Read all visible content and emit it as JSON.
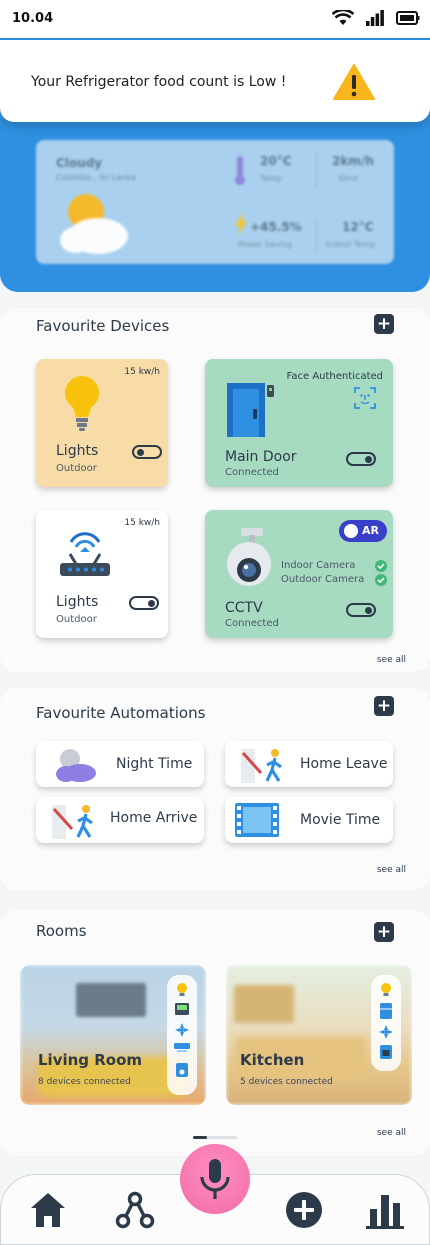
{
  "status": {
    "time": "10.04"
  },
  "notification": {
    "text": "Your Refrigerator food count is Low !"
  },
  "weather": {
    "condition": "Cloudy",
    "location": "Colombo , Sri Lanka",
    "temp": "20°C",
    "temp_label": "Temp",
    "wind": "2km/h",
    "wind_label": "Wind",
    "saving": "+45.5%",
    "saving_label": "Power Saving",
    "indoor": "12°C",
    "indoor_label": "Indoor Temp"
  },
  "favourites": {
    "title": "Favourite Devices",
    "see_all": "see all",
    "devices": [
      {
        "name": "Lights",
        "sub": "Outdoor",
        "kw": "15 kw/h"
      },
      {
        "name": "Main Door",
        "sub": "Connected",
        "note": "Face Authenticated"
      },
      {
        "name": "Lights",
        "sub": "Outdoor",
        "kw": "15 kw/h"
      },
      {
        "name": "CCTV",
        "sub": "Connected",
        "ar": "AR",
        "cam1": "Indoor Camera",
        "cam2": "Outdoor Camera"
      }
    ]
  },
  "automations": {
    "title": "Favourite Automations",
    "see_all": "see all",
    "items": [
      {
        "label": "Night Time"
      },
      {
        "label": "Home Leave"
      },
      {
        "label": "Home Arrive"
      },
      {
        "label": "Movie Time"
      }
    ]
  },
  "rooms": {
    "title": "Rooms",
    "see_all": "see all",
    "items": [
      {
        "name": "Living Room",
        "sub": "8 devices connected"
      },
      {
        "name": "Kitchen",
        "sub": "5 devices connected"
      }
    ]
  },
  "colors": {
    "accent": "#2f8fe0",
    "light_card": "#f7dca8",
    "green_card": "#a6dbc2",
    "dark": "#2d3a4a",
    "mic": "#f26aa8"
  }
}
